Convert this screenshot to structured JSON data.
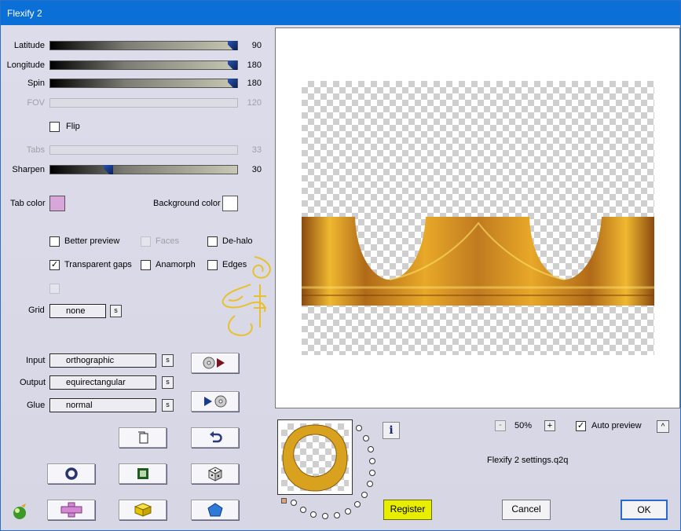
{
  "window": {
    "title": "Flexify 2"
  },
  "sliders": {
    "latitude": {
      "label": "Latitude",
      "value": "90",
      "level": 1.0
    },
    "longitude": {
      "label": "Longitude",
      "value": "180",
      "level": 1.0
    },
    "spin": {
      "label": "Spin",
      "value": "180",
      "level": 1.0
    },
    "fov": {
      "label": "FOV",
      "value": "120"
    },
    "tabs": {
      "label": "Tabs",
      "value": "33"
    },
    "sharpen": {
      "label": "Sharpen",
      "value": "30",
      "level": 0.31
    }
  },
  "flip": {
    "label": "Flip",
    "checked": false
  },
  "colors": {
    "tab_color_label": "Tab color",
    "tab_color": "#d8a6d8",
    "background_color_label": "Background color",
    "background_color": "#ffffff"
  },
  "options": {
    "better_preview": {
      "label": "Better preview",
      "checked": false
    },
    "faces": {
      "label": "Faces",
      "checked": false
    },
    "de_halo": {
      "label": "De-halo",
      "checked": false
    },
    "transparent_gaps": {
      "label": "Transparent gaps",
      "checked": true
    },
    "anamorph": {
      "label": "Anamorph",
      "checked": false
    },
    "edges": {
      "label": "Edges",
      "checked": false
    }
  },
  "grid": {
    "label": "Grid",
    "value": "none",
    "s_label": "s"
  },
  "projection": {
    "input_label": "Input",
    "input_value": "orthographic",
    "output_label": "Output",
    "output_value": "equirectangular",
    "glue_label": "Glue",
    "glue_value": "normal",
    "s_label": "s"
  },
  "zoom": {
    "minus": "-",
    "value": "50%",
    "plus": "+"
  },
  "auto_preview": {
    "label": "Auto preview",
    "checked": true,
    "collapse": "^"
  },
  "settings_file": "Flexify 2 settings.q2q",
  "info_label": "i",
  "buttons": {
    "register": "Register",
    "cancel": "Cancel",
    "ok": "OK"
  },
  "accent_colors": {
    "title_bar": "#0a6fd6",
    "register": "#e8ee00",
    "gold": "#d9a21e"
  },
  "icons": [
    "copy-icon",
    "undo-icon",
    "ring-icon",
    "square-icon",
    "dice-icon",
    "plus-icon",
    "cube-icon",
    "pentagon-icon",
    "disc-play-icon",
    "play-disc-icon",
    "logo-icon"
  ]
}
